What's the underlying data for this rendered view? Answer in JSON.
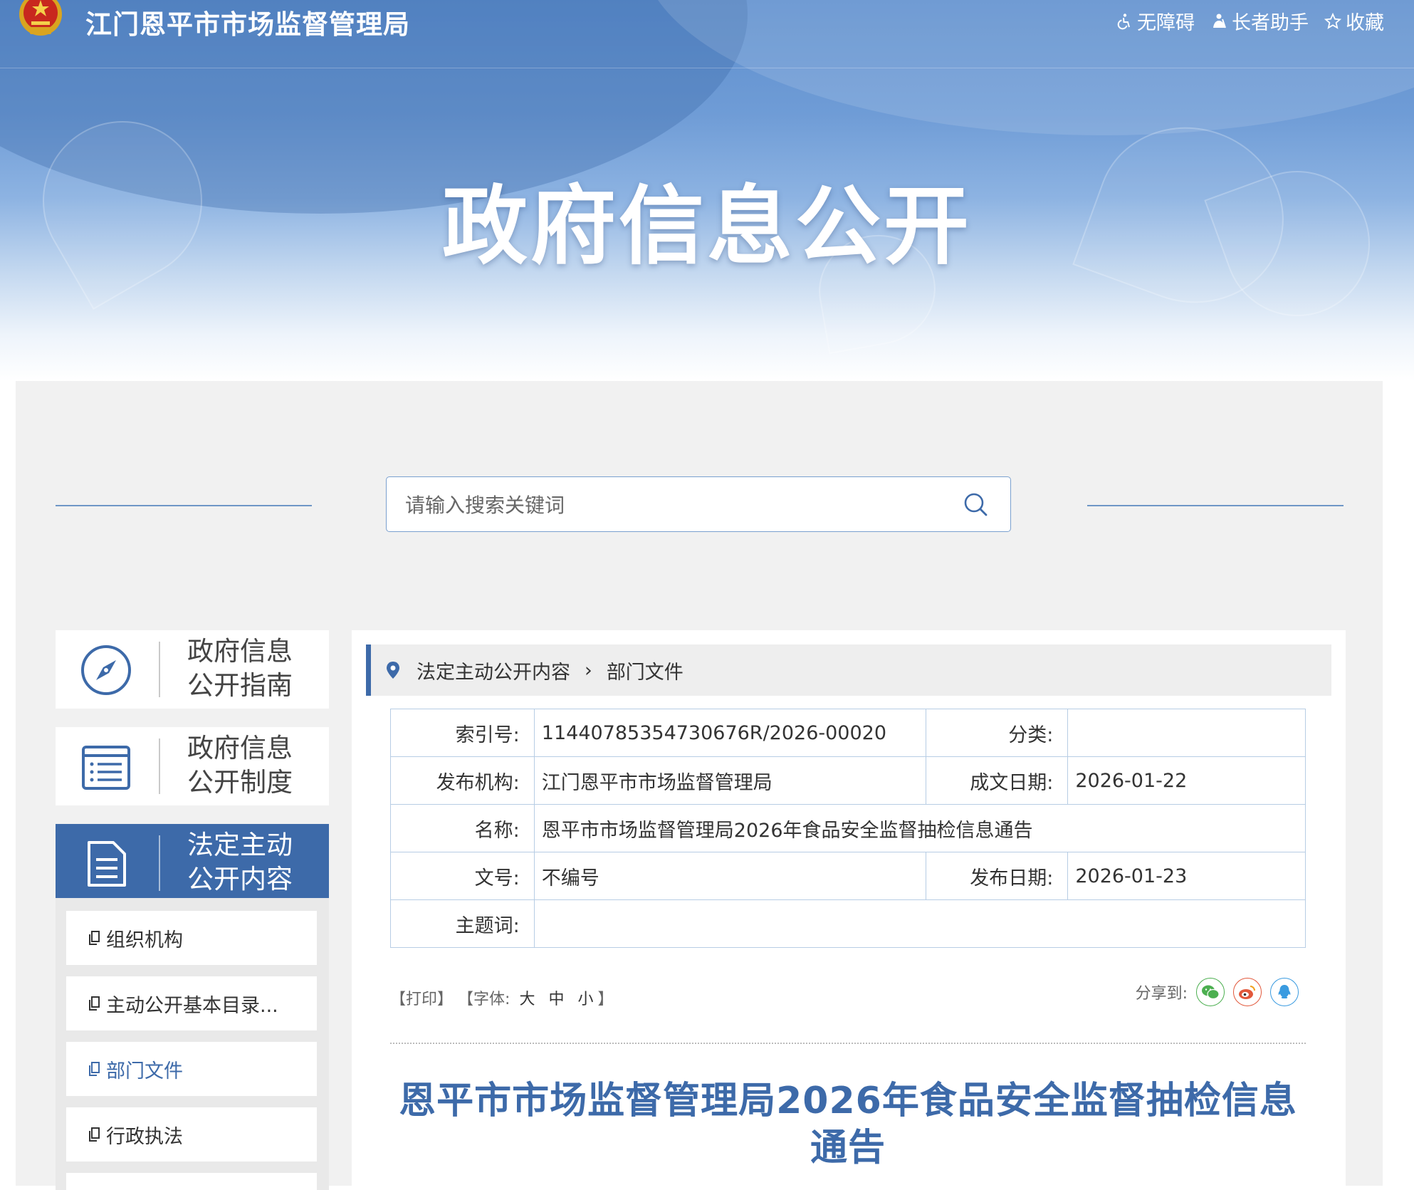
{
  "header": {
    "site_title": "江门恩平市市场监督管理局",
    "tools": [
      {
        "icon": "wheelchair-icon",
        "label": "无障碍"
      },
      {
        "icon": "elder-icon",
        "label": "长者助手"
      },
      {
        "icon": "star-icon",
        "label": "收藏"
      }
    ],
    "hero_title": "政府信息公开"
  },
  "search": {
    "placeholder": "请输入搜索关键词"
  },
  "sidebar": {
    "cards": [
      {
        "icon": "compass-icon",
        "label": "政府信息公开指南",
        "active": false
      },
      {
        "icon": "list-icon",
        "label": "政府信息公开制度",
        "active": false
      },
      {
        "icon": "document-icon",
        "label": "法定主动公开内容",
        "active": true
      }
    ],
    "subitems": [
      {
        "label": "组织机构",
        "current": false
      },
      {
        "label": "主动公开基本目录...",
        "current": false
      },
      {
        "label": "部门文件",
        "current": true
      },
      {
        "label": "行政执法",
        "current": false
      }
    ]
  },
  "breadcrumb": {
    "items": [
      "法定主动公开内容",
      "部门文件"
    ],
    "separator": "›"
  },
  "meta": {
    "index_label": "索引号:",
    "index_value": "11440785354730676R/2026-00020",
    "category_label": "分类:",
    "category_value": "",
    "publisher_label": "发布机构:",
    "publisher_value": "江门恩平市市场监督管理局",
    "created_label": "成文日期:",
    "created_value": "2026-01-22",
    "name_label": "名称:",
    "name_value": "恩平市市场监督管理局2026年食品安全监督抽检信息通告",
    "docno_label": "文号:",
    "docno_value": "不编号",
    "published_label": "发布日期:",
    "published_value": "2026-01-23",
    "keywords_label": "主题词:",
    "keywords_value": ""
  },
  "doc_tools": {
    "print": "【打印】",
    "font_prefix": "【字体:",
    "size_large": "大",
    "size_medium": "中",
    "size_small": "小",
    "font_suffix": "】",
    "share_label": "分享到:"
  },
  "share": [
    {
      "icon": "wechat-icon",
      "color": "#4caf50"
    },
    {
      "icon": "weibo-icon",
      "color": "#e2583b"
    },
    {
      "icon": "qq-icon",
      "color": "#3a9be0"
    }
  ],
  "document": {
    "title": "恩平市市场监督管理局2026年食品安全监督抽检信息通告"
  },
  "colors": {
    "brand_blue": "#3d6aa9",
    "banner_blue": "#5d8ecd",
    "panel_gray": "#f1f1f1"
  }
}
